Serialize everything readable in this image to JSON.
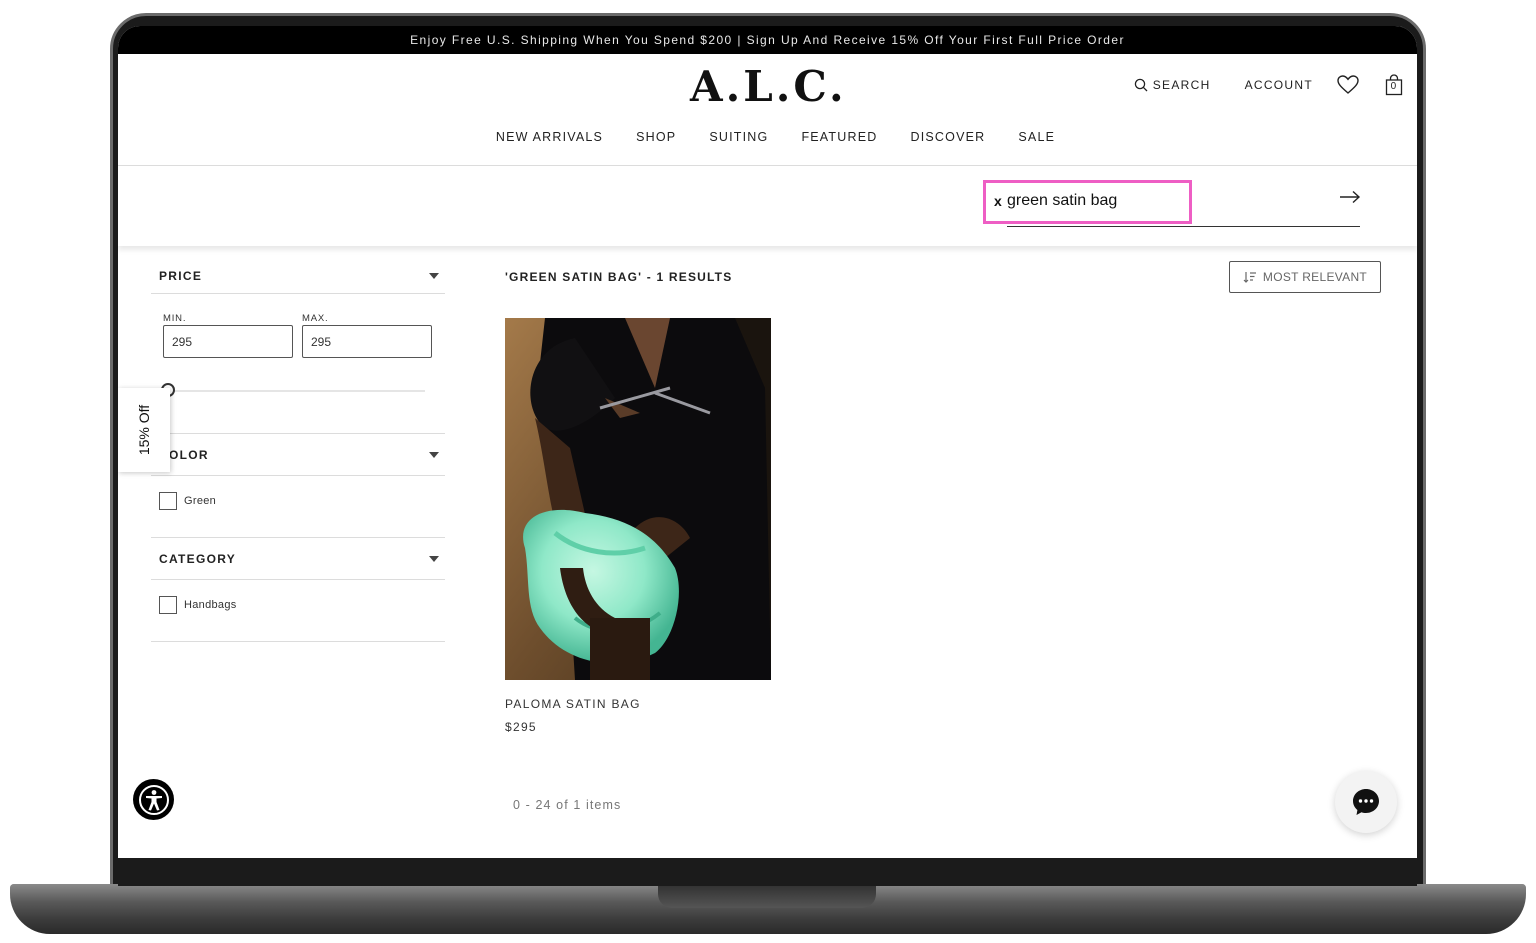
{
  "promo": {
    "text": "Enjoy Free U.S. Shipping When You Spend $200 | Sign Up And Receive 15% Off Your First Full Price Order"
  },
  "brand": {
    "logo": "A.L.C."
  },
  "header": {
    "search_label": "SEARCH",
    "account_label": "ACCOUNT",
    "cart_count": "0",
    "icons": [
      "search-icon",
      "heart-icon",
      "shopping-bag-icon"
    ]
  },
  "nav": {
    "items": [
      "NEW ARRIVALS",
      "SHOP",
      "SUITING",
      "FEATURED",
      "DISCOVER",
      "SALE"
    ]
  },
  "search": {
    "clear_label": "x",
    "query": "green satin bag",
    "submit_icon": "arrow-right-icon",
    "highlight_color": "#ee5ec4"
  },
  "filters": {
    "price": {
      "title": "PRICE",
      "min_label": "MIN.",
      "max_label": "MAX.",
      "min_value": "295",
      "max_value": "295"
    },
    "color": {
      "title": "OLOR",
      "options": [
        "Green"
      ]
    },
    "category": {
      "title": "CATEGORY",
      "options": [
        "Handbags"
      ]
    }
  },
  "discount_tab": {
    "label": "15% Off"
  },
  "results": {
    "title": "'GREEN SATIN BAG' - 1 RESULTS",
    "sort_label": "MOST RELEVANT",
    "products": [
      {
        "name": "PALOMA SATIN BAG",
        "price": "$295",
        "bag_color": "#8fe8c8"
      }
    ],
    "pager": "0 - 24 of 1 items"
  },
  "widgets": {
    "accessibility_icon": "accessibility-icon",
    "chat_icon": "chat-bubble-icon"
  }
}
